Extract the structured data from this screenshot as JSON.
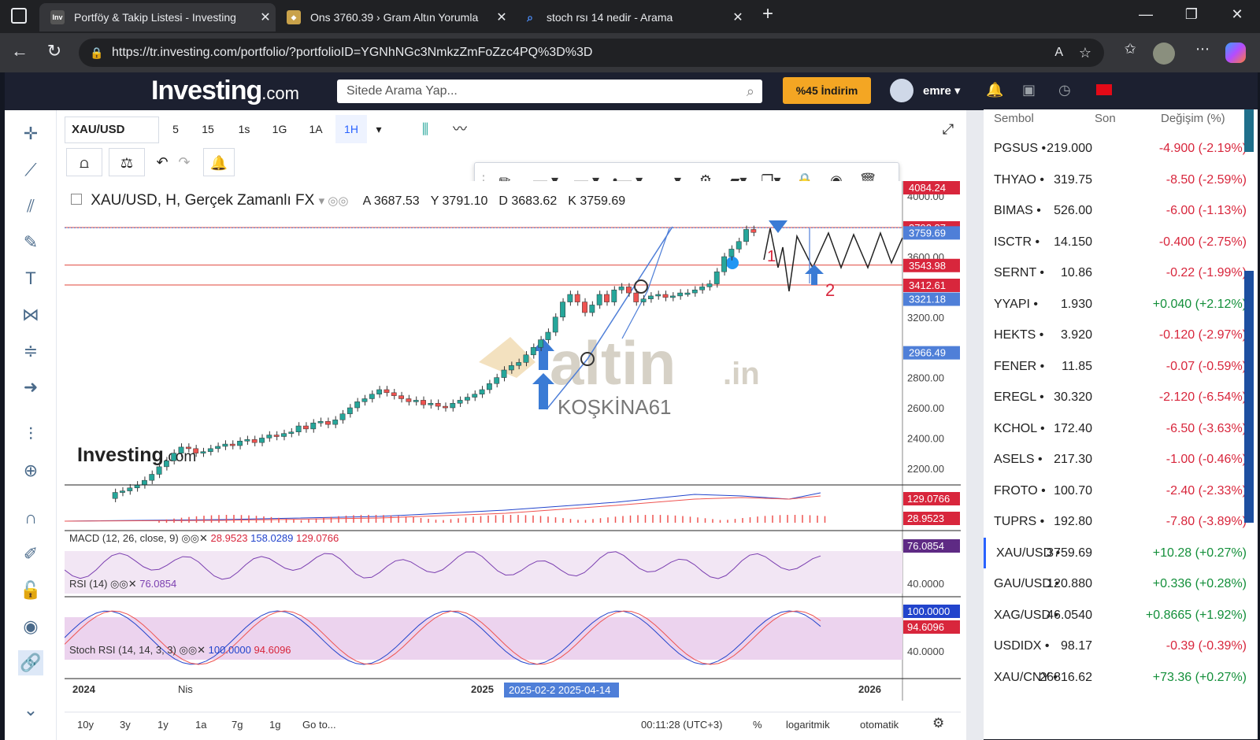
{
  "browser": {
    "tabs": [
      {
        "title": "Portföy & Takip Listesi - Investing",
        "icon": "Inv"
      },
      {
        "title": "Ons 3760.39 › Gram Altın Yorumla",
        "icon": "altin"
      },
      {
        "title": "stoch rsı 14 nedir - Arama",
        "icon": "search"
      }
    ],
    "url": "https://tr.investing.com/portfolio/?portfolioID=YGNhNGc3NmkzZmFoZzc4PQ%3D%3D"
  },
  "header": {
    "logo_main": "Investing",
    "logo_suffix": ".com",
    "search_placeholder": "Sitede Arama Yap...",
    "promo_label": "%45 İndirim",
    "user_name": "emre"
  },
  "chart_toolbar": {
    "symbol": "XAU/USD",
    "intervals": [
      "5",
      "15",
      "1s",
      "1G",
      "1A",
      "1H"
    ],
    "active_interval": "1H"
  },
  "chart_header": {
    "title": "XAU/USD, H, Gerçek Zamanlı FX",
    "ohlc": [
      {
        "k": "A",
        "v": "3687.53"
      },
      {
        "k": "Y",
        "v": "3791.10"
      },
      {
        "k": "D",
        "v": "3683.62"
      },
      {
        "k": "K",
        "v": "3759.69"
      }
    ]
  },
  "chart_data": {
    "type": "candlestick",
    "ylim": [
      2100,
      4100
    ],
    "y_ticks": [
      "4000.00",
      "3600.00",
      "3200.00",
      "2800.00",
      "2600.00",
      "2400.00",
      "2200.00"
    ],
    "x_labels": [
      "2024",
      "Nis",
      "2025",
      "2026"
    ],
    "price_labels": [
      {
        "v": "4084.24",
        "c": "#d8263c"
      },
      {
        "v": "3792.87",
        "c": "#d8263c"
      },
      {
        "v": "3759.69",
        "c": "#4f7fd8"
      },
      {
        "v": "3543.98",
        "c": "#d8263c"
      },
      {
        "v": "3412.61",
        "c": "#d8263c"
      },
      {
        "v": "3321.18",
        "c": "#4f7fd8"
      },
      {
        "v": "2966.49",
        "c": "#4f7fd8"
      }
    ],
    "range_label": "2025-02-2 2025-04-14",
    "annotations": [
      "1",
      "2"
    ],
    "watermark_main": "altin",
    "watermark_suffix": ".in",
    "watermark_author": "KOŞKİNA61",
    "chart_logo_main": "Investing",
    "chart_logo_suffix": ".com"
  },
  "indicators": {
    "macd": {
      "label": "MACD (12, 26, close, 9)",
      "v1": "28.9523",
      "v2": "158.0289",
      "v3": "129.0766",
      "axis_labels": [
        "129.0766",
        "28.9523"
      ]
    },
    "rsi": {
      "label": "RSI (14)",
      "value": "76.0854",
      "axis": "40.0000"
    },
    "stoch": {
      "label": "Stoch RSI (14, 14, 3, 3)",
      "v1": "100.0000",
      "v2": "94.6096",
      "axis": "40.0000"
    }
  },
  "bottom_bar": {
    "ranges": [
      "10y",
      "3y",
      "1y",
      "1a",
      "7g",
      "1g"
    ],
    "goto": "Go to...",
    "time": "00:11:28 (UTC+3)",
    "percent": "%",
    "log": "logaritmik",
    "auto": "otomatik"
  },
  "watchlist": {
    "headers": {
      "symbol": "Sembol",
      "last": "Son",
      "change": "Değişim (%)"
    },
    "rows": [
      {
        "sym": "PGSUS",
        "last": "219.000",
        "chg": "-4.900 (-2.19%)",
        "dir": "neg"
      },
      {
        "sym": "THYAO",
        "last": "319.75",
        "chg": "-8.50 (-2.59%)",
        "dir": "neg"
      },
      {
        "sym": "BIMAS",
        "last": "526.00",
        "chg": "-6.00 (-1.13%)",
        "dir": "neg"
      },
      {
        "sym": "ISCTR",
        "last": "14.150",
        "chg": "-0.400 (-2.75%)",
        "dir": "neg"
      },
      {
        "sym": "SERNT",
        "last": "10.86",
        "chg": "-0.22 (-1.99%)",
        "dir": "neg"
      },
      {
        "sym": "YYAPI",
        "last": "1.930",
        "chg": "+0.040 (+2.12%)",
        "dir": "pos"
      },
      {
        "sym": "HEKTS",
        "last": "3.920",
        "chg": "-0.120 (-2.97%)",
        "dir": "neg"
      },
      {
        "sym": "FENER",
        "last": "11.85",
        "chg": "-0.07 (-0.59%)",
        "dir": "neg"
      },
      {
        "sym": "EREGL",
        "last": "30.320",
        "chg": "-2.120 (-6.54%)",
        "dir": "neg"
      },
      {
        "sym": "KCHOL",
        "last": "172.40",
        "chg": "-6.50 (-3.63%)",
        "dir": "neg"
      },
      {
        "sym": "ASELS",
        "last": "217.30",
        "chg": "-1.00 (-0.46%)",
        "dir": "neg"
      },
      {
        "sym": "FROTO",
        "last": "100.70",
        "chg": "-2.40 (-2.33%)",
        "dir": "neg"
      },
      {
        "sym": "TUPRS",
        "last": "192.80",
        "chg": "-7.80 (-3.89%)",
        "dir": "neg"
      },
      {
        "sym": "XAU/USD",
        "last": "3759.69",
        "chg": "+10.28 (+0.27%)",
        "dir": "pos"
      },
      {
        "sym": "GAU/USD",
        "last": "120.880",
        "chg": "+0.336 (+0.28%)",
        "dir": "pos"
      },
      {
        "sym": "XAG/USD",
        "last": "46.0540",
        "chg": "+0.8665 (+1.92%)",
        "dir": "pos"
      },
      {
        "sym": "USDIDX",
        "last": "98.17",
        "chg": "-0.39 (-0.39%)",
        "dir": "neg"
      },
      {
        "sym": "XAU/CNY",
        "last": "26816.62",
        "chg": "+73.36 (+0.27%)",
        "dir": "pos"
      }
    ]
  }
}
